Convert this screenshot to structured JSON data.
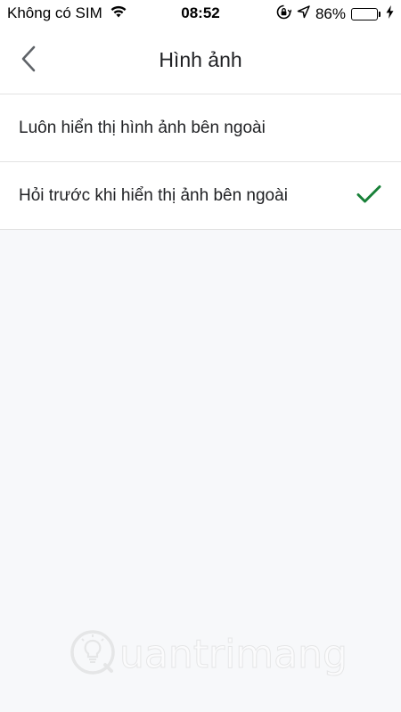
{
  "status_bar": {
    "carrier": "Không có SIM",
    "time": "08:52",
    "battery_percent": "86%",
    "battery_level": 0.86,
    "icons": [
      "wifi-icon",
      "orientation-lock-icon",
      "location-arrow-icon",
      "battery-icon",
      "charging-bolt-icon"
    ]
  },
  "header": {
    "title": "Hình ảnh",
    "back_icon": "chevron-left-icon"
  },
  "options": [
    {
      "label": "Luôn hiển thị hình ảnh bên ngoài",
      "selected": false
    },
    {
      "label": "Hỏi trước khi hiển thị ảnh bên ngoài",
      "selected": true
    }
  ],
  "colors": {
    "check": "#188038",
    "background": "#f7f8fa",
    "battery": "#4cd964"
  },
  "watermark": {
    "text": "uantrimang"
  }
}
